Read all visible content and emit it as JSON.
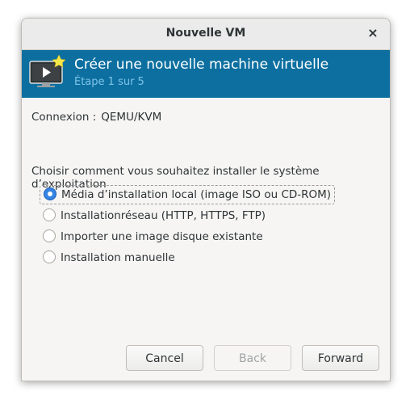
{
  "window": {
    "title": "Nouvelle VM",
    "close_glyph": "×"
  },
  "banner": {
    "title": "Créer une nouvelle machine virtuelle",
    "step": "Étape 1 sur 5",
    "icon": "vm-monitor-icon",
    "color": "#0c6fa0"
  },
  "connection": {
    "label": "Connexion :",
    "value": "QEMU/KVM"
  },
  "install": {
    "prompt": "Choisir comment vous souhaitez installer le système d’exploitation",
    "options": [
      {
        "label": "Média d’installation local (image ISO ou CD-ROM)",
        "selected": true
      },
      {
        "label": "Installationréseau (HTTP, HTTPS, FTP)",
        "selected": false
      },
      {
        "label": "Importer une image disque existante",
        "selected": false
      },
      {
        "label": "Installation manuelle",
        "selected": false
      }
    ]
  },
  "buttons": {
    "cancel": "Cancel",
    "back": "Back",
    "forward": "Forward"
  }
}
